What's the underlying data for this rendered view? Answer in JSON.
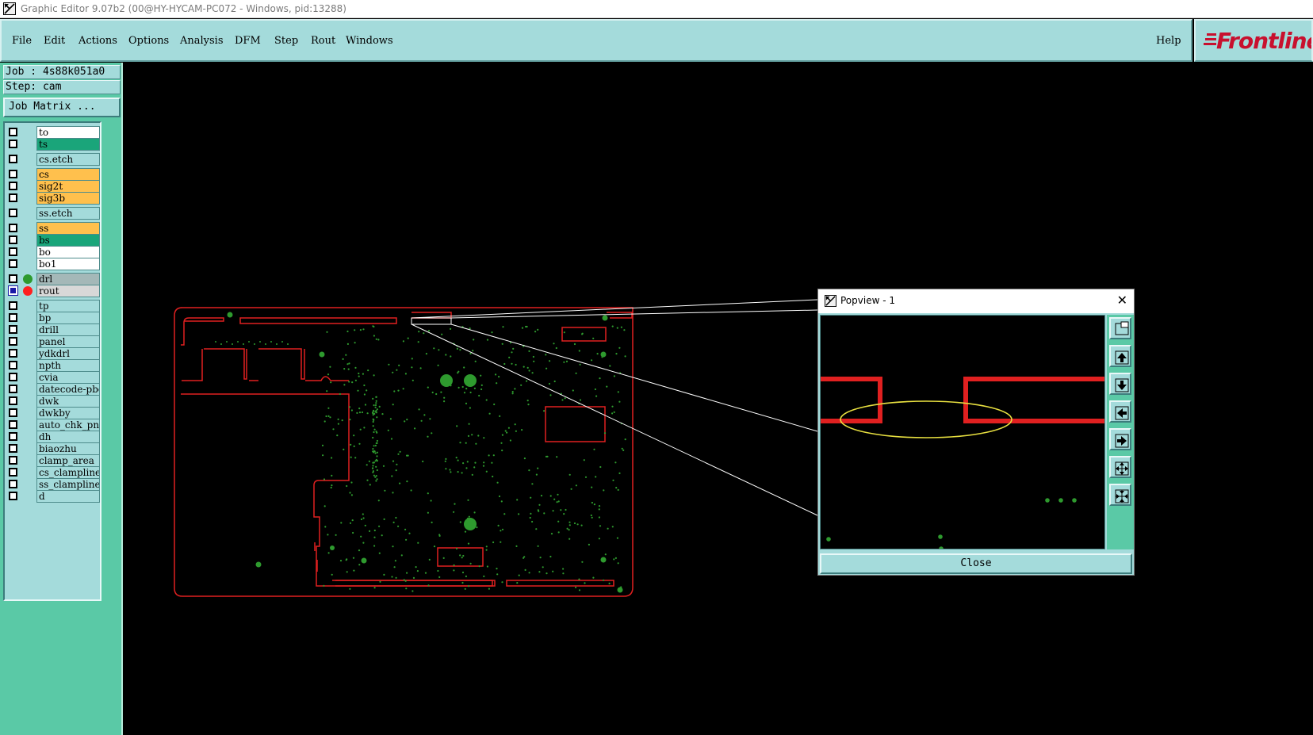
{
  "window": {
    "title": "Graphic Editor 9.07b2 (00@HY-HYCAM-PC072 - Windows, pid:13288)"
  },
  "menu": {
    "items": [
      "File",
      "Edit",
      "Actions",
      "Options",
      "Analysis",
      "DFM",
      "Step",
      "Rout",
      "Windows"
    ],
    "help": "Help"
  },
  "logo": {
    "text": "Frontline",
    "color": "#c8102e"
  },
  "job": {
    "job_label": "Job : 4s88k051a0",
    "step_label": "Step: cam",
    "matrix_button": "Job Matrix ..."
  },
  "layers": [
    {
      "name": "to",
      "color": "#ffffff",
      "checked": false,
      "group": 0
    },
    {
      "name": "ts",
      "color": "#1aa57a",
      "checked": false,
      "group": 0
    },
    {
      "name": "cs.etch",
      "color": "#a4dbdb",
      "checked": false,
      "group": 1
    },
    {
      "name": "cs",
      "color": "#ffc04d",
      "checked": false,
      "group": 2
    },
    {
      "name": "sig2t",
      "color": "#ffc04d",
      "checked": false,
      "group": 2
    },
    {
      "name": "sig3b",
      "color": "#ffc04d",
      "checked": false,
      "group": 2
    },
    {
      "name": "ss.etch",
      "color": "#a4dbdb",
      "checked": false,
      "group": 3
    },
    {
      "name": "ss",
      "color": "#ffc04d",
      "checked": false,
      "group": 4
    },
    {
      "name": "bs",
      "color": "#1aa57a",
      "checked": false,
      "group": 4
    },
    {
      "name": "bo",
      "color": "#ffffff",
      "checked": false,
      "group": 4
    },
    {
      "name": "bo1",
      "color": "#ffffff",
      "checked": false,
      "group": 4
    },
    {
      "name": "drl",
      "color": "#a4b8b8",
      "checked": false,
      "group": 5,
      "dot": "#2e9a2e"
    },
    {
      "name": "rout",
      "color": "#d8d8d8",
      "checked": true,
      "group": 5,
      "dot": "#ff2020"
    },
    {
      "name": "tp",
      "color": "#a4dbdb",
      "checked": false,
      "group": 6
    },
    {
      "name": "bp",
      "color": "#a4dbdb",
      "checked": false,
      "group": 6
    },
    {
      "name": "drill",
      "color": "#a4dbdb",
      "checked": false,
      "group": 6
    },
    {
      "name": "panel",
      "color": "#a4dbdb",
      "checked": false,
      "group": 6
    },
    {
      "name": "ydkdrl",
      "color": "#a4dbdb",
      "checked": false,
      "group": 6
    },
    {
      "name": "npth",
      "color": "#a4dbdb",
      "checked": false,
      "group": 6
    },
    {
      "name": "cvia",
      "color": "#a4dbdb",
      "checked": false,
      "group": 6
    },
    {
      "name": "datecode-pbc",
      "color": "#a4dbdb",
      "checked": false,
      "group": 6
    },
    {
      "name": "dwk",
      "color": "#a4dbdb",
      "checked": false,
      "group": 6
    },
    {
      "name": "dwkby",
      "color": "#a4dbdb",
      "checked": false,
      "group": 6
    },
    {
      "name": "auto_chk_pnl",
      "color": "#a4dbdb",
      "checked": false,
      "group": 6
    },
    {
      "name": "dh",
      "color": "#a4dbdb",
      "checked": false,
      "group": 6
    },
    {
      "name": "biaozhu",
      "color": "#a4dbdb",
      "checked": false,
      "group": 6
    },
    {
      "name": "clamp_area",
      "color": "#a4dbdb",
      "checked": false,
      "group": 6
    },
    {
      "name": "cs_clampline",
      "color": "#a4dbdb",
      "checked": false,
      "group": 6
    },
    {
      "name": "ss_clampline",
      "color": "#a4dbdb",
      "checked": false,
      "group": 6
    },
    {
      "name": "d",
      "color": "#a4dbdb",
      "checked": false,
      "group": 6
    }
  ],
  "colors": {
    "rout": "#e02020",
    "drill": "#2e9a2e",
    "highlight": "#e8e040",
    "zoom_lines": "#ffffff"
  },
  "popview": {
    "title": "Popview - 1",
    "close_button": "Close",
    "tools": [
      "zoom-fit-icon",
      "pan-up-icon",
      "pan-down-icon",
      "pan-left-icon",
      "pan-right-icon",
      "zoom-in-icon",
      "zoom-out-icon"
    ]
  }
}
